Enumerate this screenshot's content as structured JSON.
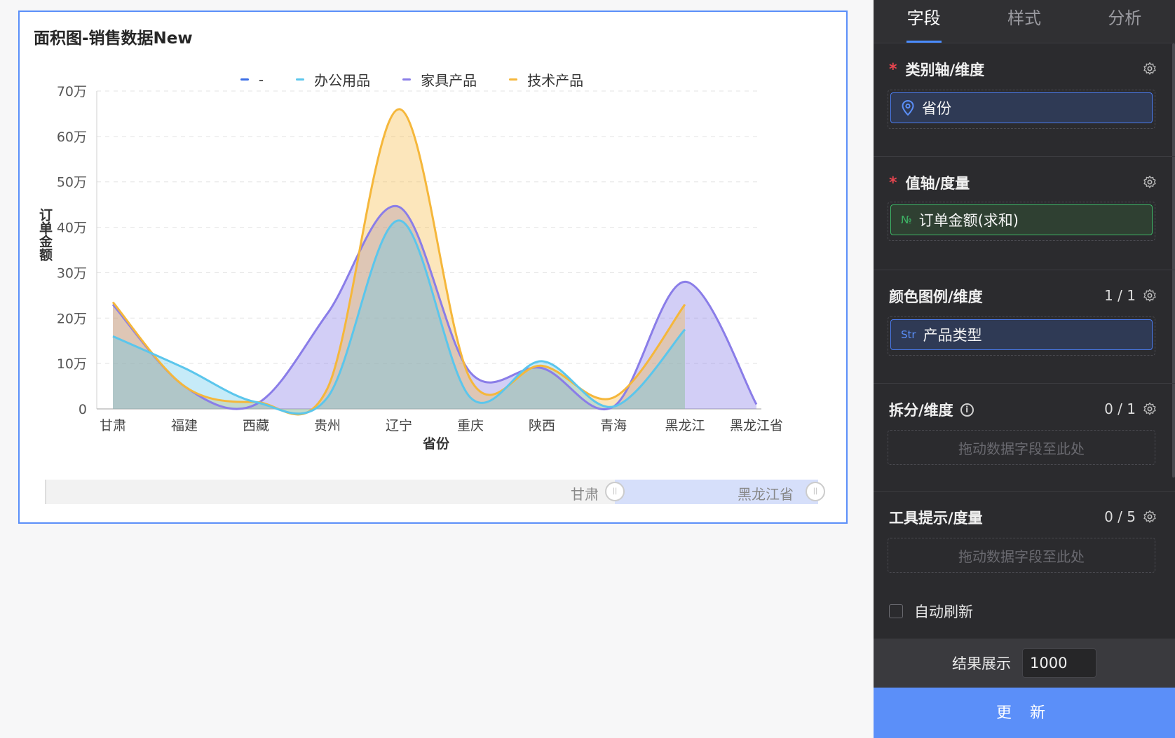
{
  "card": {
    "title": "面积图-销售数据New"
  },
  "legend": [
    {
      "label": "-",
      "color": "#3b6ee6"
    },
    {
      "label": "办公用品",
      "color": "#5bc6ec"
    },
    {
      "label": "家具产品",
      "color": "#8a7de8"
    },
    {
      "label": "技术产品",
      "color": "#f5b73b"
    }
  ],
  "chart_data": {
    "type": "area",
    "title": "面积图-销售数据New",
    "xlabel": "省份",
    "ylabel": "订单金额",
    "categories": [
      "甘肃",
      "福建",
      "西藏",
      "贵州",
      "辽宁",
      "重庆",
      "陕西",
      "青海",
      "黑龙江",
      "黑龙江省"
    ],
    "y_ticks": [
      "0",
      "10万",
      "20万",
      "30万",
      "40万",
      "50万",
      "60万",
      "70万"
    ],
    "ylim": [
      0,
      700000
    ],
    "grid": true,
    "legend_position": "top",
    "series": [
      {
        "name": "办公用品",
        "color": "#5bc6ec",
        "values": [
          160000,
          90000,
          15000,
          25000,
          415000,
          25000,
          105000,
          5000,
          175000,
          null
        ]
      },
      {
        "name": "家具产品",
        "color": "#8a7de8",
        "values": [
          230000,
          50000,
          10000,
          210000,
          445000,
          80000,
          90000,
          5000,
          280000,
          10000
        ]
      },
      {
        "name": "技术产品",
        "color": "#f5b73b",
        "values": [
          235000,
          50000,
          15000,
          45000,
          660000,
          65000,
          95000,
          25000,
          230000,
          null
        ]
      }
    ]
  },
  "slider": {
    "start_label": "甘肃",
    "end_label": "黑龙江省"
  },
  "panel": {
    "tabs": [
      "字段",
      "样式",
      "分析"
    ],
    "category_axis": {
      "label": "类别轴/维度",
      "field": "省份"
    },
    "value_axis": {
      "label": "值轴/度量",
      "field": "订单金额(求和)",
      "field_icon": "№"
    },
    "color_legend": {
      "label": "颜色图例/维度",
      "count": "1 / 1",
      "field": "产品类型",
      "field_icon": "Str"
    },
    "split": {
      "label": "拆分/维度",
      "count": "0 / 1",
      "placeholder": "拖动数据字段至此处"
    },
    "tooltip": {
      "label": "工具提示/度量",
      "count": "0 / 5",
      "placeholder": "拖动数据字段至此处"
    },
    "auto_refresh": "自动刷新",
    "result_label": "结果展示",
    "result_value": "1000",
    "update_button": "更 新"
  }
}
